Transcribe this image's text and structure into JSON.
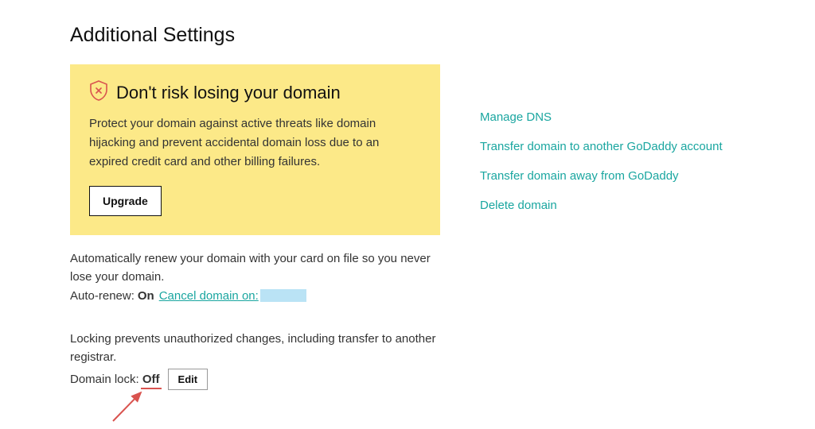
{
  "page": {
    "title": "Additional Settings"
  },
  "warning": {
    "title": "Don't risk losing your domain",
    "body": "Protect your domain against active threats like domain hijacking and prevent accidental domain loss due to an expired credit card and other billing failures.",
    "upgrade_label": "Upgrade"
  },
  "auto_renew": {
    "description": "Automatically renew your domain with your card on file so you never lose your domain.",
    "label": "Auto-renew:",
    "status": "On",
    "cancel_link": "Cancel domain on:"
  },
  "domain_lock": {
    "description": "Locking prevents unauthorized changes, including transfer to another registrar.",
    "label": "Domain lock:",
    "status": "Off",
    "edit_label": "Edit"
  },
  "actions": {
    "manage_dns": "Manage DNS",
    "transfer_to_account": "Transfer domain to another GoDaddy account",
    "transfer_away": "Transfer domain away from GoDaddy",
    "delete_domain": "Delete domain"
  }
}
